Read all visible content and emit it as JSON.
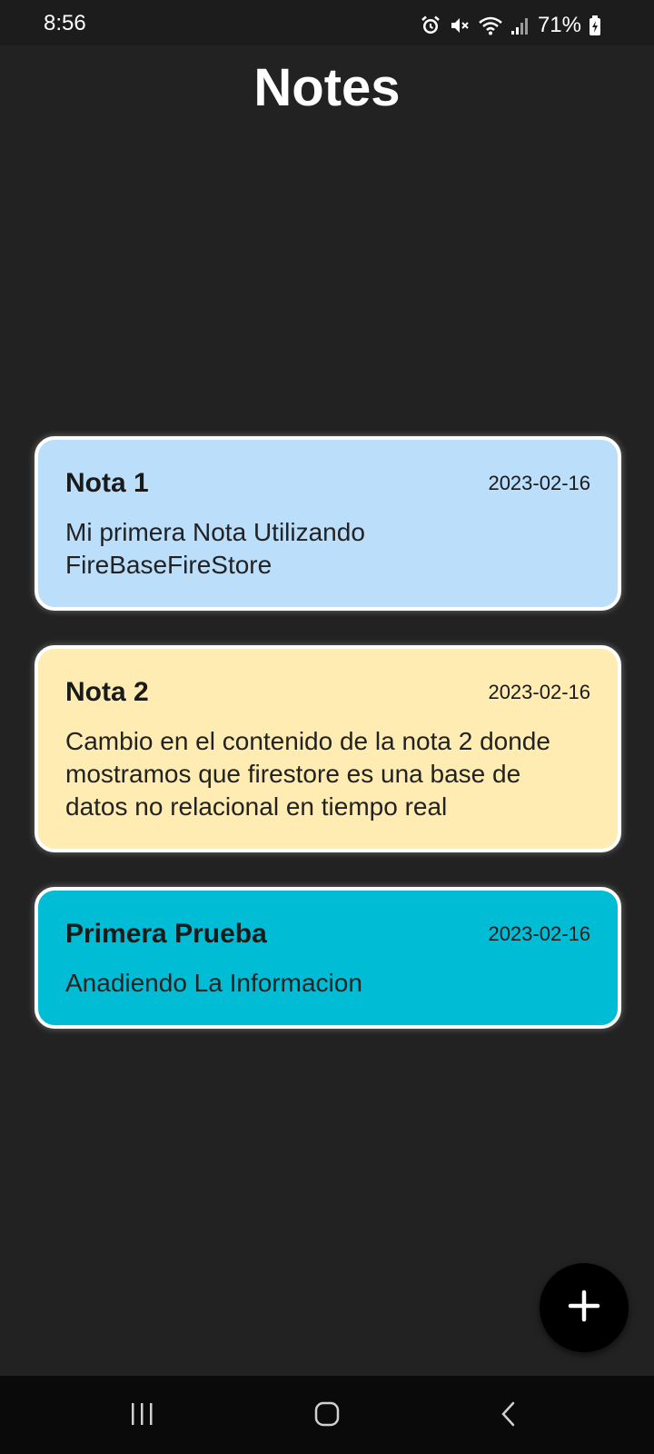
{
  "status_bar": {
    "time": "8:56",
    "battery_percent": "71%",
    "icons": [
      "alarm-icon",
      "mute-icon",
      "wifi-icon",
      "signal-icon",
      "battery-charging-icon"
    ]
  },
  "header": {
    "title": "Notes"
  },
  "notes": [
    {
      "title": "Nota 1",
      "date": "2023-02-16",
      "body": "Mi primera Nota Utilizando FireBaseFireStore",
      "color": "#bbdefb"
    },
    {
      "title": "Nota 2",
      "date": "2023-02-16",
      "body": "Cambio en el contenido de la nota 2 donde mostramos que firestore es una base de datos no relacional en tiempo real",
      "color": "#ffecb3"
    },
    {
      "title": "Primera Prueba",
      "date": "2023-02-16",
      "body": "Anadiendo La Informacion",
      "color": "#00bcd4"
    }
  ],
  "fab": {
    "icon": "plus-icon",
    "background": "#000000"
  },
  "nav_bar": {
    "icons": [
      "recent-apps-icon",
      "home-icon",
      "back-icon"
    ]
  },
  "colors": {
    "background": "#222222",
    "status_bar": "#1c1c1c",
    "nav_bar": "#0a0a0a"
  }
}
